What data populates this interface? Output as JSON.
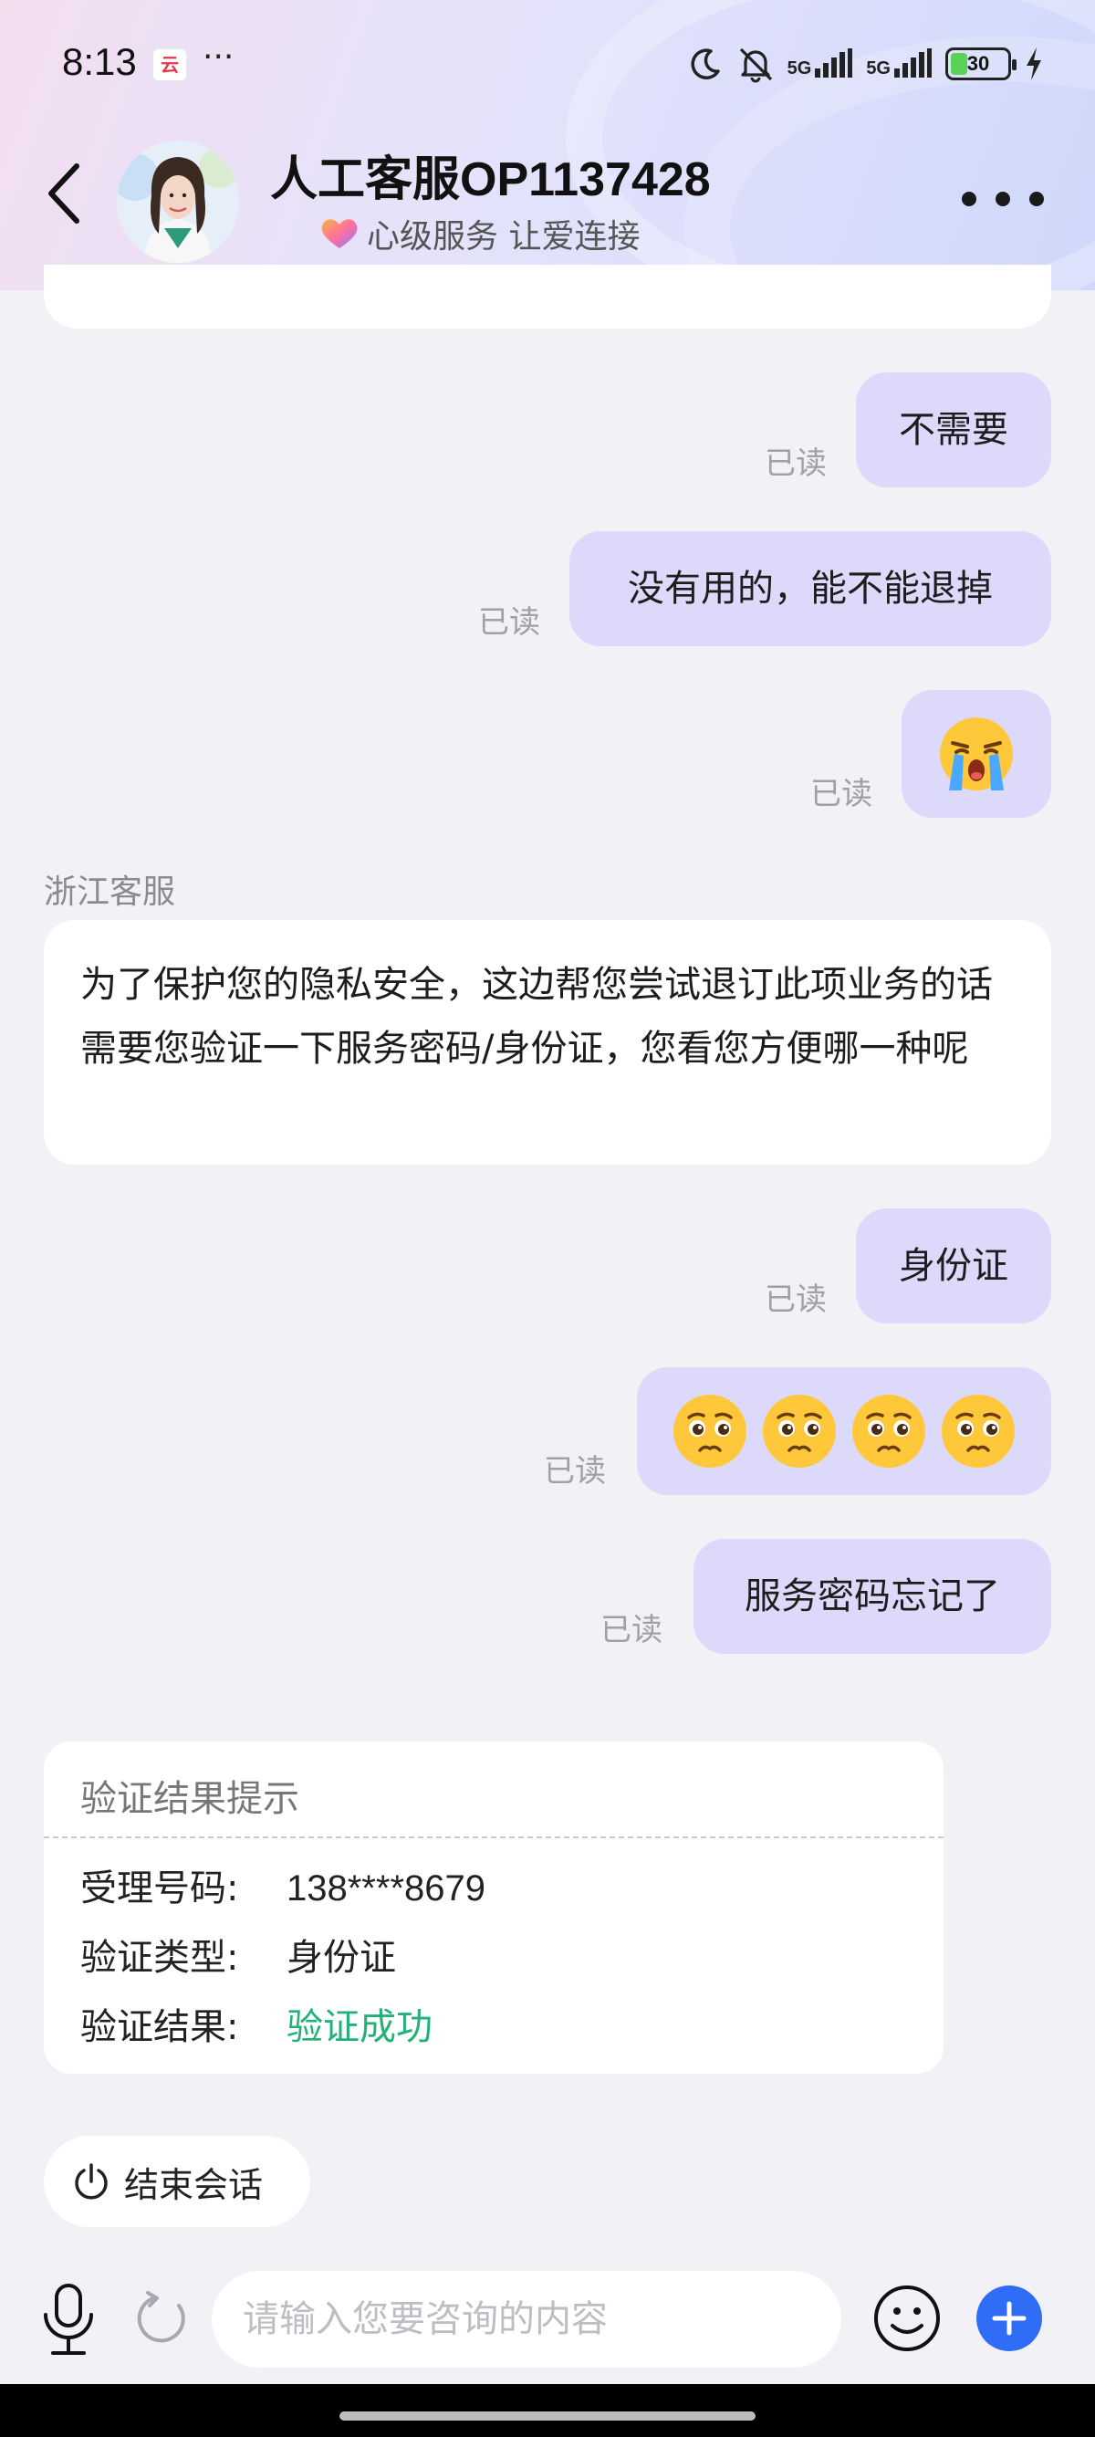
{
  "status_bar": {
    "time": "8:13",
    "app_badge": "云",
    "overflow": "···",
    "net1": "5G",
    "net2": "5G",
    "battery": "30",
    "battery_level": 0.3,
    "icons": [
      "moon-icon",
      "silent-bell-icon",
      "signal-icon",
      "signal-icon",
      "battery-icon",
      "charging-icon"
    ]
  },
  "header": {
    "agent_name": "人工客服OP1137428",
    "slogan": "心级服务 让爱连接",
    "back_icon": "chevron-left-icon",
    "menu_icon": "more-dots-icon"
  },
  "messages": [
    {
      "from": "me",
      "text": "不需要",
      "read": "已读"
    },
    {
      "from": "me",
      "text": "没有用的，能不能退掉",
      "read": "已读"
    },
    {
      "from": "me",
      "text": "😭",
      "read": "已读"
    },
    {
      "from": "agent",
      "sender": "浙江客服",
      "text": "为了保护您的隐私安全，这边帮您尝试退订此项业务的话需要您验证一下服务密码/身份证，您看您方便哪一种呢"
    },
    {
      "from": "me",
      "text": "身份证",
      "read": "已读"
    },
    {
      "from": "me",
      "text": "🥺🥺🥺🥺",
      "read": "已读"
    },
    {
      "from": "me",
      "text": "服务密码忘记了",
      "read": "已读"
    }
  ],
  "verify_card": {
    "title": "验证结果提示",
    "rows": [
      {
        "label": "受理号码:",
        "value": "138****8679"
      },
      {
        "label": "验证类型:",
        "value": "身份证"
      },
      {
        "label": "验证结果:",
        "value": "验证成功"
      }
    ],
    "success_color": "#22b278"
  },
  "end_session": {
    "label": "结束会话"
  },
  "input": {
    "placeholder": "请输入您要咨询的内容",
    "value": ""
  },
  "colors": {
    "accent": "#2f6df6",
    "outgoing_bubble": "#ddd9fb",
    "background": "#f1f1f6"
  }
}
